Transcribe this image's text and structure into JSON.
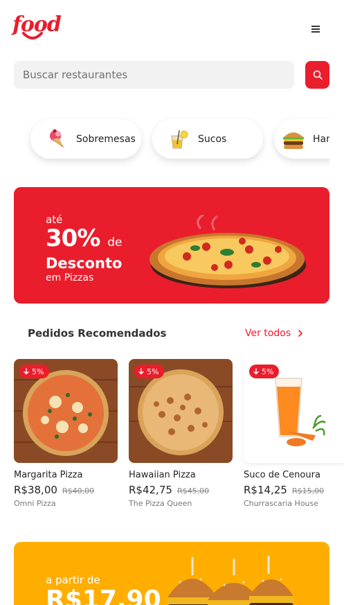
{
  "header": {
    "logo_text": "food"
  },
  "search": {
    "placeholder": "Buscar restaurantes"
  },
  "categories": [
    {
      "label": "Sobremesas",
      "icon": "ice-cream-icon"
    },
    {
      "label": "Sucos",
      "icon": "juice-icon"
    },
    {
      "label": "Hambúrgueres",
      "icon": "burger-icon"
    }
  ],
  "promo": {
    "line1": "até",
    "percent": "30%",
    "de": "de",
    "desconto": "Desconto",
    "line4": "em Pizzas"
  },
  "recommended": {
    "title": "Pedidos Recomendados",
    "see_all": "Ver todos",
    "items": [
      {
        "badge": "5%",
        "name": "Margarita Pizza",
        "price": "R$38,00",
        "old_price": "R$40,00",
        "store": "Omni Pizza"
      },
      {
        "badge": "5%",
        "name": "Hawaiian Pizza",
        "price": "R$42,75",
        "old_price": "R$45,00",
        "store": "The Pizza Queen"
      },
      {
        "badge": "5%",
        "name": "Suco de Cenoura",
        "price": "R$14,25",
        "old_price": "R$15,00",
        "store": "Churrascaria House"
      }
    ]
  },
  "promo2": {
    "line1": "a partir de",
    "price": "R$17,90"
  },
  "colors": {
    "brand": "#ea1d2c",
    "promo2": "#ffae00"
  }
}
